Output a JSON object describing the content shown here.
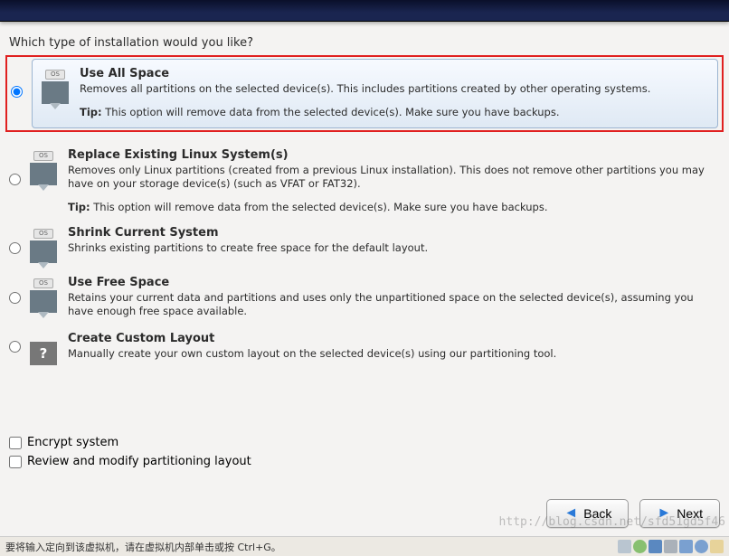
{
  "prompt": "Which type of installation would you like?",
  "options": {
    "use_all": {
      "icon_badge": "OS",
      "title": "Use All Space",
      "desc": "Removes all partitions on the selected device(s).  This includes partitions created by other operating systems.",
      "tip_label": "Tip:",
      "tip": " This option will remove data from the selected device(s).  Make sure you have backups."
    },
    "replace": {
      "icon_badge": "OS",
      "title": "Replace Existing Linux System(s)",
      "desc": "Removes only Linux partitions (created from a previous Linux installation).  This does not remove other partitions you may have on your storage device(s) (such as VFAT or FAT32).",
      "tip_label": "Tip:",
      "tip": " This option will remove data from the selected device(s).  Make sure you have backups."
    },
    "shrink": {
      "icon_badge": "OS",
      "title": "Shrink Current System",
      "desc": "Shrinks existing partitions to create free space for the default layout."
    },
    "free": {
      "icon_badge": "OS",
      "title": "Use Free Space",
      "desc": "Retains your current data and partitions and uses only the unpartitioned space on the selected device(s), assuming you have enough free space available."
    },
    "custom": {
      "icon_badge": "?",
      "title": "Create Custom Layout",
      "desc": "Manually create your own custom layout on the selected device(s) using our partitioning tool."
    }
  },
  "checkboxes": {
    "encrypt": "Encrypt system",
    "review": "Review and modify partitioning layout"
  },
  "buttons": {
    "back": "Back",
    "next": "Next"
  },
  "statusbar": {
    "text": "要将输入定向到该虚拟机，请在虚拟机内部单击或按 Ctrl+G。"
  },
  "watermark": "http://blog.csdn.net/sfd51gd5f46"
}
